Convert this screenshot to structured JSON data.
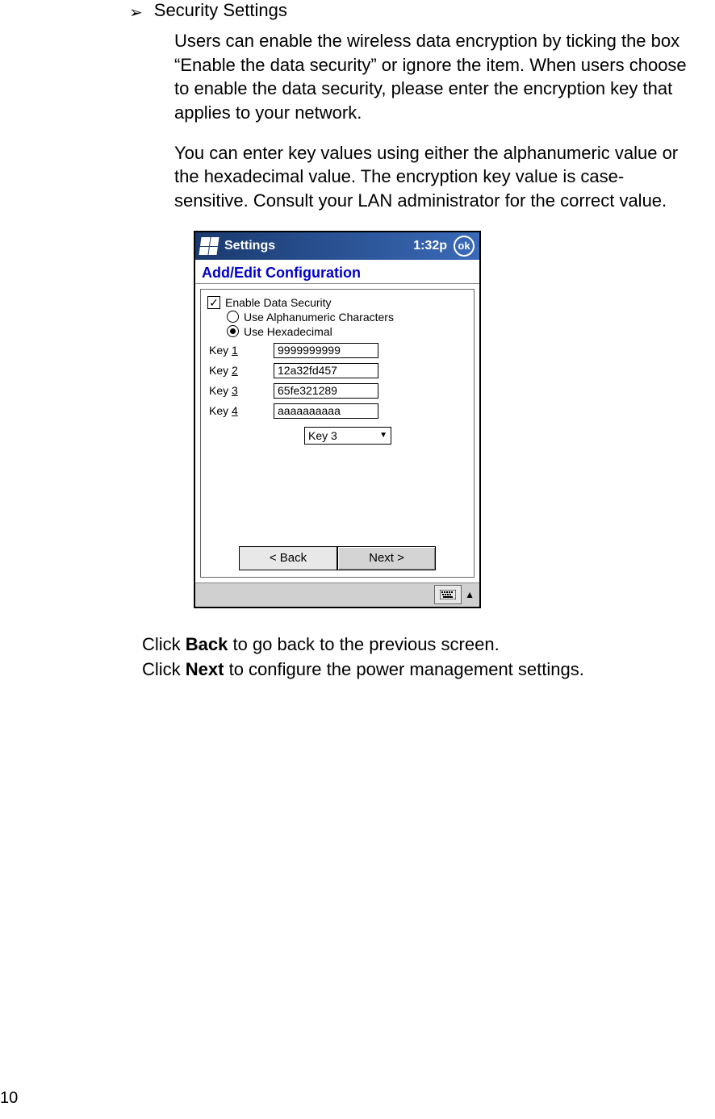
{
  "section": {
    "title": "Security Settings",
    "para1": "Users can enable the wireless data encryption by ticking the box “Enable the data security” or ignore the item. When users choose to enable the data security, please enter the encryption key that applies to your network.",
    "para2": "You can enter key values using either the alphanumeric value or the hexadecimal value. The encryption key value is case-sensitive. Consult your LAN administrator for the correct value."
  },
  "pda": {
    "title": "Settings",
    "time": "1:32p",
    "ok": "ok",
    "header": "Add/Edit Configuration",
    "enable_label": "Enable Data Security",
    "radio_alpha": "Use Alphanumeric Characters",
    "radio_hex": "Use Hexadecimal",
    "keys": [
      {
        "label_prefix": "Key ",
        "label_num": "1",
        "value": "9999999999"
      },
      {
        "label_prefix": "Key ",
        "label_num": "2",
        "value": "12a32fd457"
      },
      {
        "label_prefix": "Key ",
        "label_num": "3",
        "value": "65fe321289"
      },
      {
        "label_prefix": "Key ",
        "label_num": "4",
        "value": "aaaaaaaaaa"
      }
    ],
    "selected_key": "Key 3",
    "back_btn": "< Back",
    "next_btn": "Next >"
  },
  "instructions": {
    "click_back_pre": "Click ",
    "click_back_bold": "Back",
    "click_back_post": " to go back to the previous screen.",
    "click_next_pre": "Click ",
    "click_next_bold": "Next",
    "click_next_post": " to configure the power management settings."
  },
  "page_number": "10"
}
